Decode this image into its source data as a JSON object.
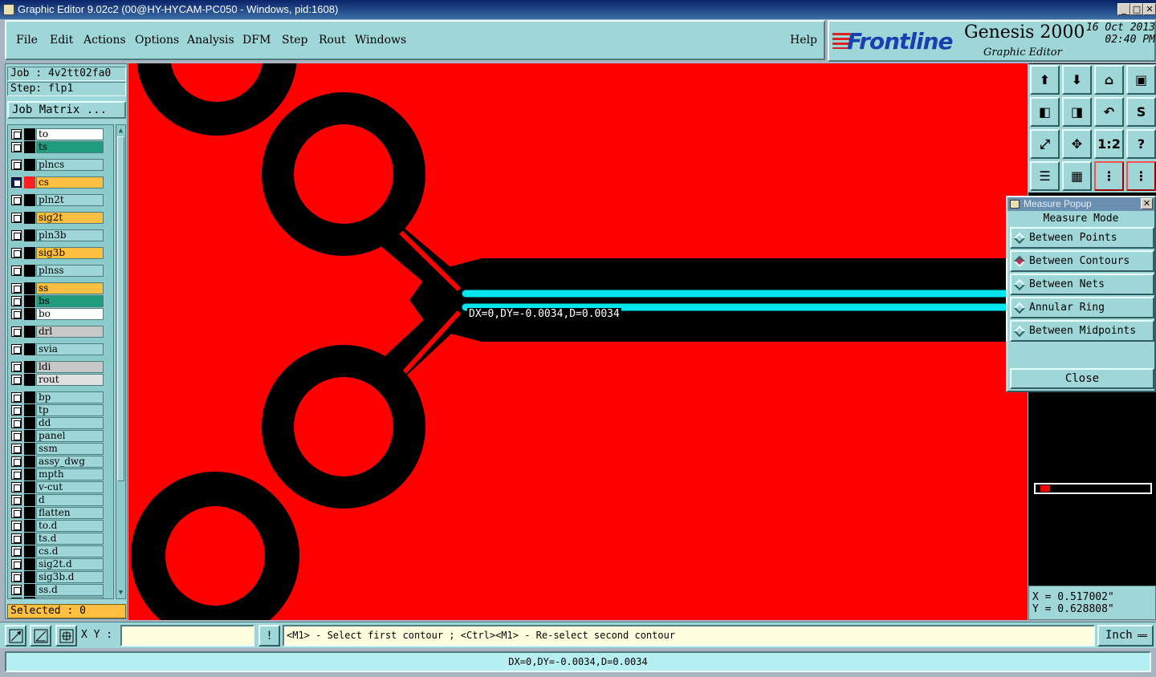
{
  "window": {
    "title": "Graphic Editor 9.02c2 (00@HY-HYCAM-PC050 - Windows, pid:1608)",
    "min_label": "_",
    "max_label": "□",
    "close_label": "✕"
  },
  "menu": {
    "items": [
      "File",
      "Edit",
      "Actions",
      "Options",
      "Analysis",
      "DFM",
      "Step",
      "Rout",
      "Windows"
    ],
    "help": "Help"
  },
  "brand": {
    "logo": "Frontline",
    "product": "Genesis 2000",
    "subtitle": "Graphic Editor",
    "date": "16 Oct 2013",
    "time": "02:40 PM"
  },
  "job": {
    "job_label": "Job : 4v2tt02fa0",
    "step_label": "Step: flp1",
    "matrix_button": "Job Matrix ..."
  },
  "layers": [
    {
      "name": "to",
      "color": "#ffffff"
    },
    {
      "name": "ts",
      "color": "#1e9c7c"
    },
    {
      "name": "plncs",
      "color": "#9fd7d8"
    },
    {
      "name": "cs",
      "color": "#ffbf40",
      "active": true
    },
    {
      "name": "pln2t",
      "color": "#9fd7d8"
    },
    {
      "name": "sig2t",
      "color": "#ffbf40"
    },
    {
      "name": "pln3b",
      "color": "#9fd7d8"
    },
    {
      "name": "sig3b",
      "color": "#ffbf40"
    },
    {
      "name": "plnss",
      "color": "#9fd7d8"
    },
    {
      "name": "ss",
      "color": "#ffbf40"
    },
    {
      "name": "bs",
      "color": "#1e9c7c"
    },
    {
      "name": "bo",
      "color": "#ffffff"
    },
    {
      "name": "drl",
      "color": "#c8c8c8"
    },
    {
      "name": "svia",
      "color": "#9fd7d8"
    },
    {
      "name": "ldi",
      "color": "#c8c8c8"
    },
    {
      "name": "rout",
      "color": "#e0e0e0"
    },
    {
      "name": "bp",
      "color": "#9fd7d8"
    },
    {
      "name": "tp",
      "color": "#9fd7d8"
    },
    {
      "name": "dd",
      "color": "#9fd7d8"
    },
    {
      "name": "panel",
      "color": "#9fd7d8"
    },
    {
      "name": "ssm",
      "color": "#9fd7d8"
    },
    {
      "name": "assy_dwg",
      "color": "#9fd7d8"
    },
    {
      "name": "mpth",
      "color": "#9fd7d8"
    },
    {
      "name": "v-cut",
      "color": "#9fd7d8"
    },
    {
      "name": "d",
      "color": "#9fd7d8"
    },
    {
      "name": "flatten",
      "color": "#9fd7d8"
    },
    {
      "name": "to.d",
      "color": "#9fd7d8"
    },
    {
      "name": "ts.d",
      "color": "#9fd7d8"
    },
    {
      "name": "cs.d",
      "color": "#9fd7d8"
    },
    {
      "name": "sig2t.d",
      "color": "#9fd7d8"
    },
    {
      "name": "sig3b.d",
      "color": "#9fd7d8"
    },
    {
      "name": "ss.d",
      "color": "#9fd7d8"
    },
    {
      "name": "bs.d",
      "color": "#9fd7d8"
    }
  ],
  "selected_label": "Selected : 0",
  "canvas": {
    "measure_text": "DX=0,DY=-0.0034,D=0.0034"
  },
  "tools": [
    "move-up-icon",
    "move-down-icon",
    "home-icon",
    "window-icon",
    "pan-left-icon",
    "pan-right-icon",
    "undo-zoom-icon",
    "redraw-icon",
    "zoom-fit-icon",
    "zoom-center-icon",
    "one-to-one-icon",
    "help-icon",
    "settings-icon",
    "grid-icon",
    "measure-icon",
    "measure-alt-icon"
  ],
  "tool_texts": {
    "one_to_one": "1:2",
    "help": "?"
  },
  "measure_popup": {
    "title": "Measure Popup",
    "close_x": "✕",
    "mode_title": "Measure Mode",
    "options": [
      "Between Points",
      "Between Contours",
      "Between Nets",
      "Annular Ring",
      "Between Midpoints"
    ],
    "selected_index": 1,
    "close_button": "Close"
  },
  "coords": {
    "x": "X = 0.517002\"",
    "y": "Y = 0.628808\""
  },
  "bottom": {
    "xy_label": "X Y :",
    "xy_value": "",
    "alert": "!",
    "prompt": "<M1> - Select first contour ; <Ctrl><M1> - Re-select second contour",
    "units": "Inch"
  },
  "status": "DX=0,DY=-0.0034,D=0.0034",
  "colors": {
    "panel": "#9fd7d8",
    "copper": "#ff0000",
    "highlight": "#00e5ee"
  }
}
